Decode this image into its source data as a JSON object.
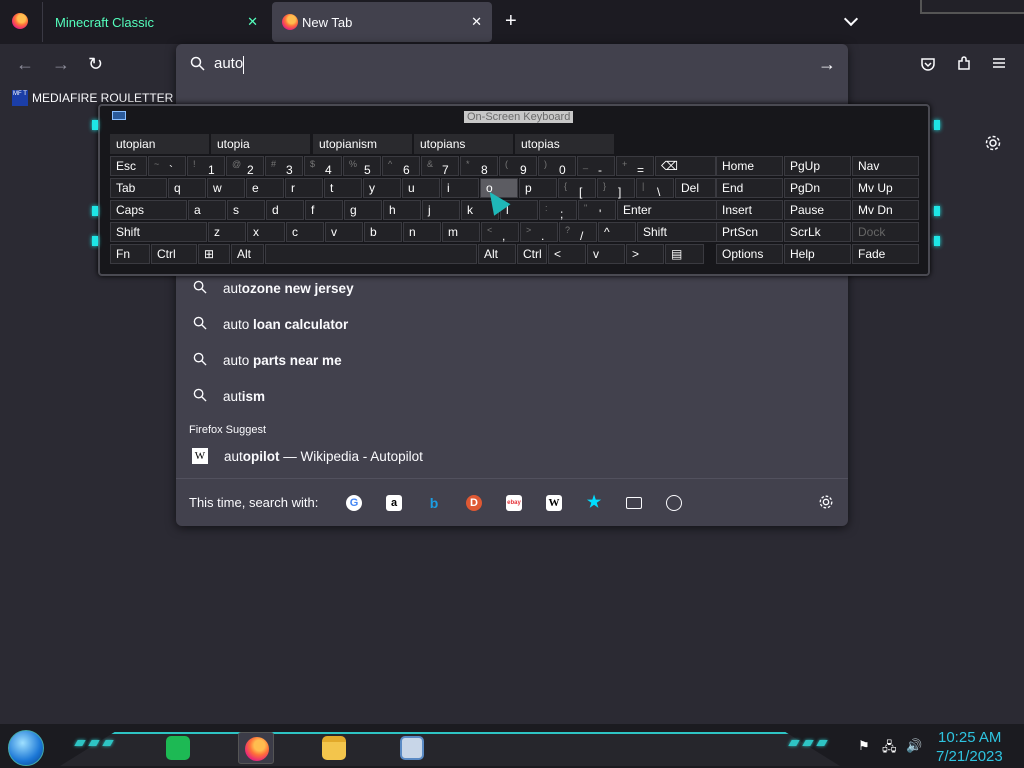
{
  "tabs": [
    {
      "label": "Minecraft Classic",
      "close": "✕"
    },
    {
      "label": "New Tab",
      "close": "✕"
    }
  ],
  "new_tab": "+",
  "bookmarks": [
    {
      "label": "MEDIAFIRE ROULETTER",
      "icon_text": "MF T"
    }
  ],
  "url_bar": {
    "value": "auto",
    "go": "→"
  },
  "suggestions": [
    {
      "typed": "aut",
      "rest": "ozone new jersey"
    },
    {
      "typed": "auto",
      "rest": " loan calculator"
    },
    {
      "typed": "auto",
      "rest": " parts near me"
    },
    {
      "typed": "aut",
      "rest": "ism"
    }
  ],
  "firefox_suggest": {
    "heading": "Firefox Suggest",
    "typed": "aut",
    "rest": "opilot",
    "sep": " — Wikipedia - Autopilot",
    "icon": "W"
  },
  "one_off": {
    "label": "This time, search with:",
    "engines": [
      "G",
      "a",
      "b",
      "D",
      "ebay",
      "W"
    ]
  },
  "osk": {
    "title": "On-Screen Keyboard",
    "predictions": [
      "utopian",
      "utopia",
      "utopianism",
      "utopians",
      "utopias"
    ],
    "row1": [
      {
        "k": "Esc"
      },
      {
        "s": "~",
        "m": "`"
      },
      {
        "s": "!",
        "m": "1"
      },
      {
        "s": "@",
        "m": "2"
      },
      {
        "s": "#",
        "m": "3"
      },
      {
        "s": "$",
        "m": "4"
      },
      {
        "s": "%",
        "m": "5"
      },
      {
        "s": "^",
        "m": "6"
      },
      {
        "s": "&",
        "m": "7"
      },
      {
        "s": "*",
        "m": "8"
      },
      {
        "s": "(",
        "m": "9"
      },
      {
        "s": ")",
        "m": "0"
      },
      {
        "s": "_",
        "m": "-"
      },
      {
        "s": "+",
        "m": "="
      },
      {
        "k": "⌫"
      }
    ],
    "row2": [
      {
        "k": "Tab"
      },
      {
        "k": "q"
      },
      {
        "k": "w"
      },
      {
        "k": "e"
      },
      {
        "k": "r"
      },
      {
        "k": "t"
      },
      {
        "k": "y"
      },
      {
        "k": "u"
      },
      {
        "k": "i"
      },
      {
        "k": "o"
      },
      {
        "k": "p"
      },
      {
        "s": "{",
        "m": "["
      },
      {
        "s": "}",
        "m": "]"
      },
      {
        "s": "|",
        "m": "\\"
      },
      {
        "k": "Del"
      }
    ],
    "row3": [
      {
        "k": "Caps"
      },
      {
        "k": "a"
      },
      {
        "k": "s"
      },
      {
        "k": "d"
      },
      {
        "k": "f"
      },
      {
        "k": "g"
      },
      {
        "k": "h"
      },
      {
        "k": "j"
      },
      {
        "k": "k"
      },
      {
        "k": "l"
      },
      {
        "s": ":",
        "m": ";"
      },
      {
        "s": "\"",
        "m": "'"
      },
      {
        "k": "Enter"
      }
    ],
    "row4": [
      {
        "k": "Shift"
      },
      {
        "k": "z"
      },
      {
        "k": "x"
      },
      {
        "k": "c"
      },
      {
        "k": "v"
      },
      {
        "k": "b"
      },
      {
        "k": "n"
      },
      {
        "k": "m"
      },
      {
        "s": "<",
        "m": ","
      },
      {
        "s": ">",
        "m": "."
      },
      {
        "s": "?",
        "m": "/"
      },
      {
        "k": "^"
      },
      {
        "k": "Shift"
      }
    ],
    "row5": [
      {
        "k": "Fn"
      },
      {
        "k": "Ctrl"
      },
      {
        "k": "⊞"
      },
      {
        "k": "Alt"
      },
      {
        "k": ""
      },
      {
        "k": "Alt"
      },
      {
        "k": "Ctrl"
      },
      {
        "k": "<"
      },
      {
        "k": "v"
      },
      {
        "k": ">"
      },
      {
        "k": "▤"
      }
    ],
    "nav": [
      [
        "Home",
        "PgUp",
        "Nav"
      ],
      [
        "End",
        "PgDn",
        "Mv Up"
      ],
      [
        "Insert",
        "Pause",
        "Mv Dn"
      ],
      [
        "PrtScn",
        "ScrLk",
        "Dock"
      ],
      [
        "Options",
        "Help",
        "Fade"
      ]
    ]
  },
  "clock": {
    "time": "10:25 AM",
    "date": "7/21/2023"
  }
}
